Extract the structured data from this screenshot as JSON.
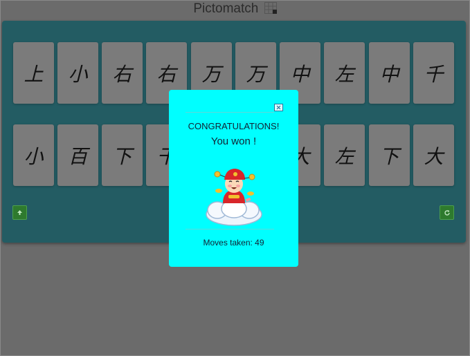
{
  "app": {
    "title": "Pictomatch",
    "title_icon": "grid-icon"
  },
  "board": {
    "row1": [
      "上",
      "小",
      "右",
      "右",
      "万",
      "万",
      "中",
      "左",
      "中",
      "千"
    ],
    "row2": [
      "小",
      "百",
      "下",
      "干",
      "",
      "",
      "大",
      "左",
      "下",
      "大"
    ],
    "left_button_icon": "arrow-up-icon",
    "right_button_icon": "restart-icon"
  },
  "modal": {
    "heading": "CONGRATULATIONS!",
    "subheading": "You won !",
    "moves": "Moves taken: 49",
    "close_icon": "close-icon",
    "illustration": "god-of-wealth-on-cloud"
  },
  "colors": {
    "overlay": "#6b6b6b",
    "board": "#235c63",
    "card": "#7b7b7b",
    "modal": "#00ffff",
    "button": "#2e7a2e"
  }
}
